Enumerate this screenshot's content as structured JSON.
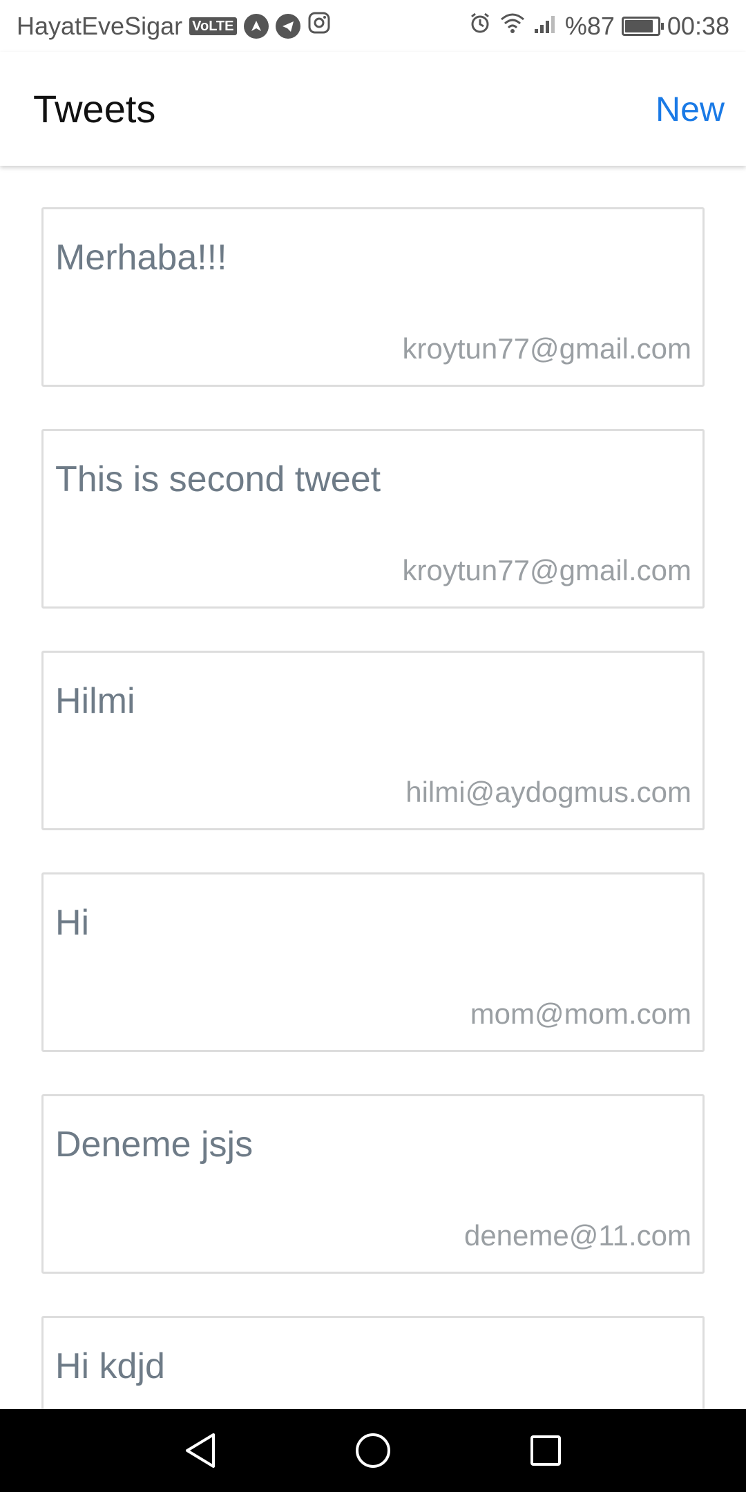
{
  "status_bar": {
    "carrier": "HayatEveSigar",
    "volte": "VoLTE",
    "battery_percent": "%87",
    "battery_level": 0.87,
    "time": "00:38",
    "icons": [
      "alarm-icon",
      "wifi-icon",
      "signal-icon",
      "battery-icon",
      "navigation-icon",
      "telegram-icon",
      "instagram-icon"
    ]
  },
  "header": {
    "title": "Tweets",
    "new_label": "New",
    "accent_color": "#1a7ae6"
  },
  "tweets": [
    {
      "text": "Merhaba!!!",
      "email": "kroytun77@gmail.com"
    },
    {
      "text": "This is second tweet",
      "email": "kroytun77@gmail.com"
    },
    {
      "text": "Hilmi",
      "email": "hilmi@aydogmus.com"
    },
    {
      "text": "Hi",
      "email": "mom@mom.com"
    },
    {
      "text": "Deneme jsjs",
      "email": "deneme@11.com"
    },
    {
      "text": "Hi kdjd",
      "email": ""
    }
  ],
  "nav_bar": {
    "icons": [
      "back-icon",
      "home-icon",
      "recents-icon"
    ]
  }
}
